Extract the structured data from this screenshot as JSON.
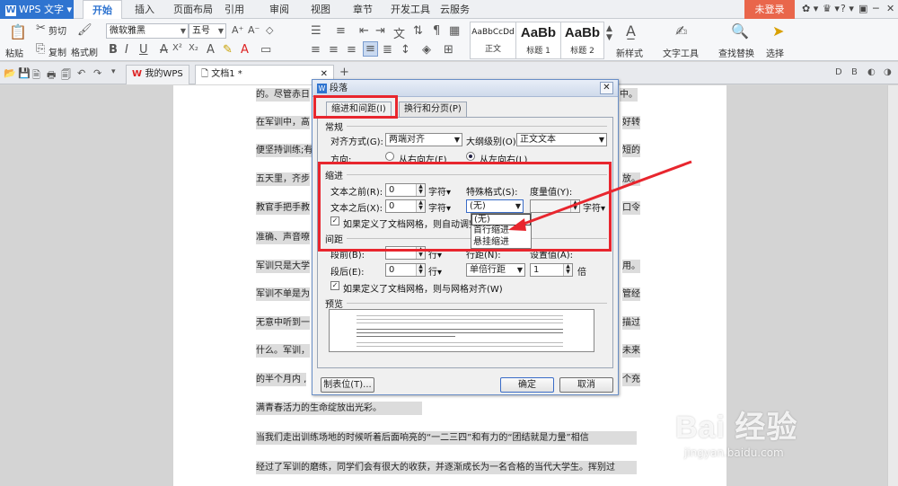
{
  "app": {
    "name": "WPS 文字"
  },
  "menu": [
    "开始",
    "插入",
    "页面布局",
    "引用",
    "审阅",
    "视图",
    "章节",
    "开发工具",
    "云服务"
  ],
  "login_label": "未登录",
  "ribbon": {
    "paste": "粘贴",
    "cut": "剪切",
    "copy": "复制",
    "format_painter": "格式刷",
    "font_name": "微软雅黑",
    "font_size": "五号",
    "styles": [
      {
        "sample": "AaBbCcDd",
        "name": "正文"
      },
      {
        "sample": "AaBb",
        "name": "标题 1"
      },
      {
        "sample": "AaBb",
        "name": "标题 2"
      }
    ],
    "new_style": "新样式",
    "text_tools": "文字工具",
    "find_replace": "查找替换",
    "select": "选择"
  },
  "tabs": {
    "my_wps": "我的WPS",
    "doc": "文档1 *"
  },
  "document_lines": [
    "的。尽管赤日",
    "在军训中，高",
    "便坚持训练;有",
    "五天里，齐步",
    "教官手把手教",
    "准确、声音嘹",
    "军训只是大学",
    "军训不单是为",
    "无意中听到一",
    "什么。军训，",
    "的半个月内 ,",
    "满青春活力的生命绽放出光彩。",
    "当我们走出训练场地的时候听着后面响亮的“一二三四”和有力的“团结就是力量”相信",
    "经过了军训的磨练，同学们会有很大的收获，并逐渐成长为一名合格的当代大学生。挥别过"
  ],
  "document_right": [
    "中。",
    "好转",
    "短的",
    "放。",
    "口令",
    "用。",
    "管经",
    "描过",
    "未来",
    "个充"
  ],
  "dialog": {
    "title": "段落",
    "tabs": [
      "缩进和间距(I)",
      "换行和分页(P)"
    ],
    "general": {
      "group": "常规",
      "align_label": "对齐方式(G):",
      "align_value": "两端对齐",
      "outline_label": "大纲级别(O):",
      "outline_value": "正文文本",
      "direction_label": "方向:",
      "rtl": "从右向左(F)",
      "ltr": "从左向右(L)"
    },
    "indent": {
      "group": "缩进",
      "before_label": "文本之前(R):",
      "before_value": "0",
      "before_unit": "字符",
      "after_label": "文本之后(X):",
      "after_value": "0",
      "after_unit": "字符",
      "special_label": "特殊格式(S):",
      "special_value": "(无)",
      "measure_label": "度量值(Y):",
      "measure_unit": "字符",
      "auto_adjust": "如果定义了文档网格，则自动调整",
      "special_options": [
        "(无)",
        "首行缩进",
        "悬挂缩进"
      ]
    },
    "spacing": {
      "group": "间距",
      "before_label": "段前(B):",
      "before_unit": "行",
      "after_label": "段后(E):",
      "after_value": "0",
      "after_unit": "行",
      "line_label": "行距(N):",
      "line_value": "单倍行距",
      "setting_label": "设置值(A):",
      "setting_value": "1",
      "setting_unit": "倍",
      "snap": "如果定义了文档网格，则与网格对齐(W)"
    },
    "preview_group": "预览",
    "tab_stops": "制表位(T)...",
    "ok": "确定",
    "cancel": "取消"
  },
  "watermark": {
    "brand": "Bai 经验",
    "url": "jingyan.baidu.com"
  },
  "colors": {
    "accent": "#2f74d0",
    "annotation_red": "#e8262e",
    "login": "#e9664b"
  }
}
